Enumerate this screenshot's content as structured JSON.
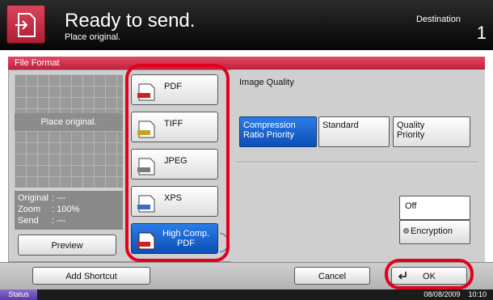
{
  "header": {
    "title": "Ready to send.",
    "subtitle": "Place original.",
    "destination_label": "Destination",
    "destination_count": "1"
  },
  "screen_title": "File Format",
  "preview": {
    "placeholder": "Place original.",
    "info": [
      {
        "key": "Original",
        "value": ": ---"
      },
      {
        "key": "Zoom",
        "value": ": 100%"
      },
      {
        "key": "Send",
        "value": ": ---"
      }
    ],
    "preview_label": "Preview"
  },
  "formats": [
    {
      "label": "PDF",
      "selected": false
    },
    {
      "label": "TIFF",
      "selected": false
    },
    {
      "label": "JPEG",
      "selected": false
    },
    {
      "label": "XPS",
      "selected": false
    },
    {
      "label": "High Comp. PDF",
      "selected": true
    }
  ],
  "image_quality": {
    "label": "Image Quality",
    "options": [
      {
        "label": "Compression Ratio Priority",
        "selected": true
      },
      {
        "label": "Standard",
        "selected": false
      },
      {
        "label": "Quality Priority",
        "selected": false
      }
    ]
  },
  "encryption": {
    "value": "Off",
    "button_label": "Encryption"
  },
  "bottom": {
    "add_shortcut": "Add Shortcut",
    "cancel": "Cancel",
    "ok": "OK"
  },
  "status_bar": {
    "status_label": "Status",
    "date": "08/08/2009",
    "time": "10:10"
  },
  "colors": {
    "accent_red": "#c01f3c",
    "selected_blue": "#0d4fb7",
    "highlight_ring": "#e3001b"
  }
}
